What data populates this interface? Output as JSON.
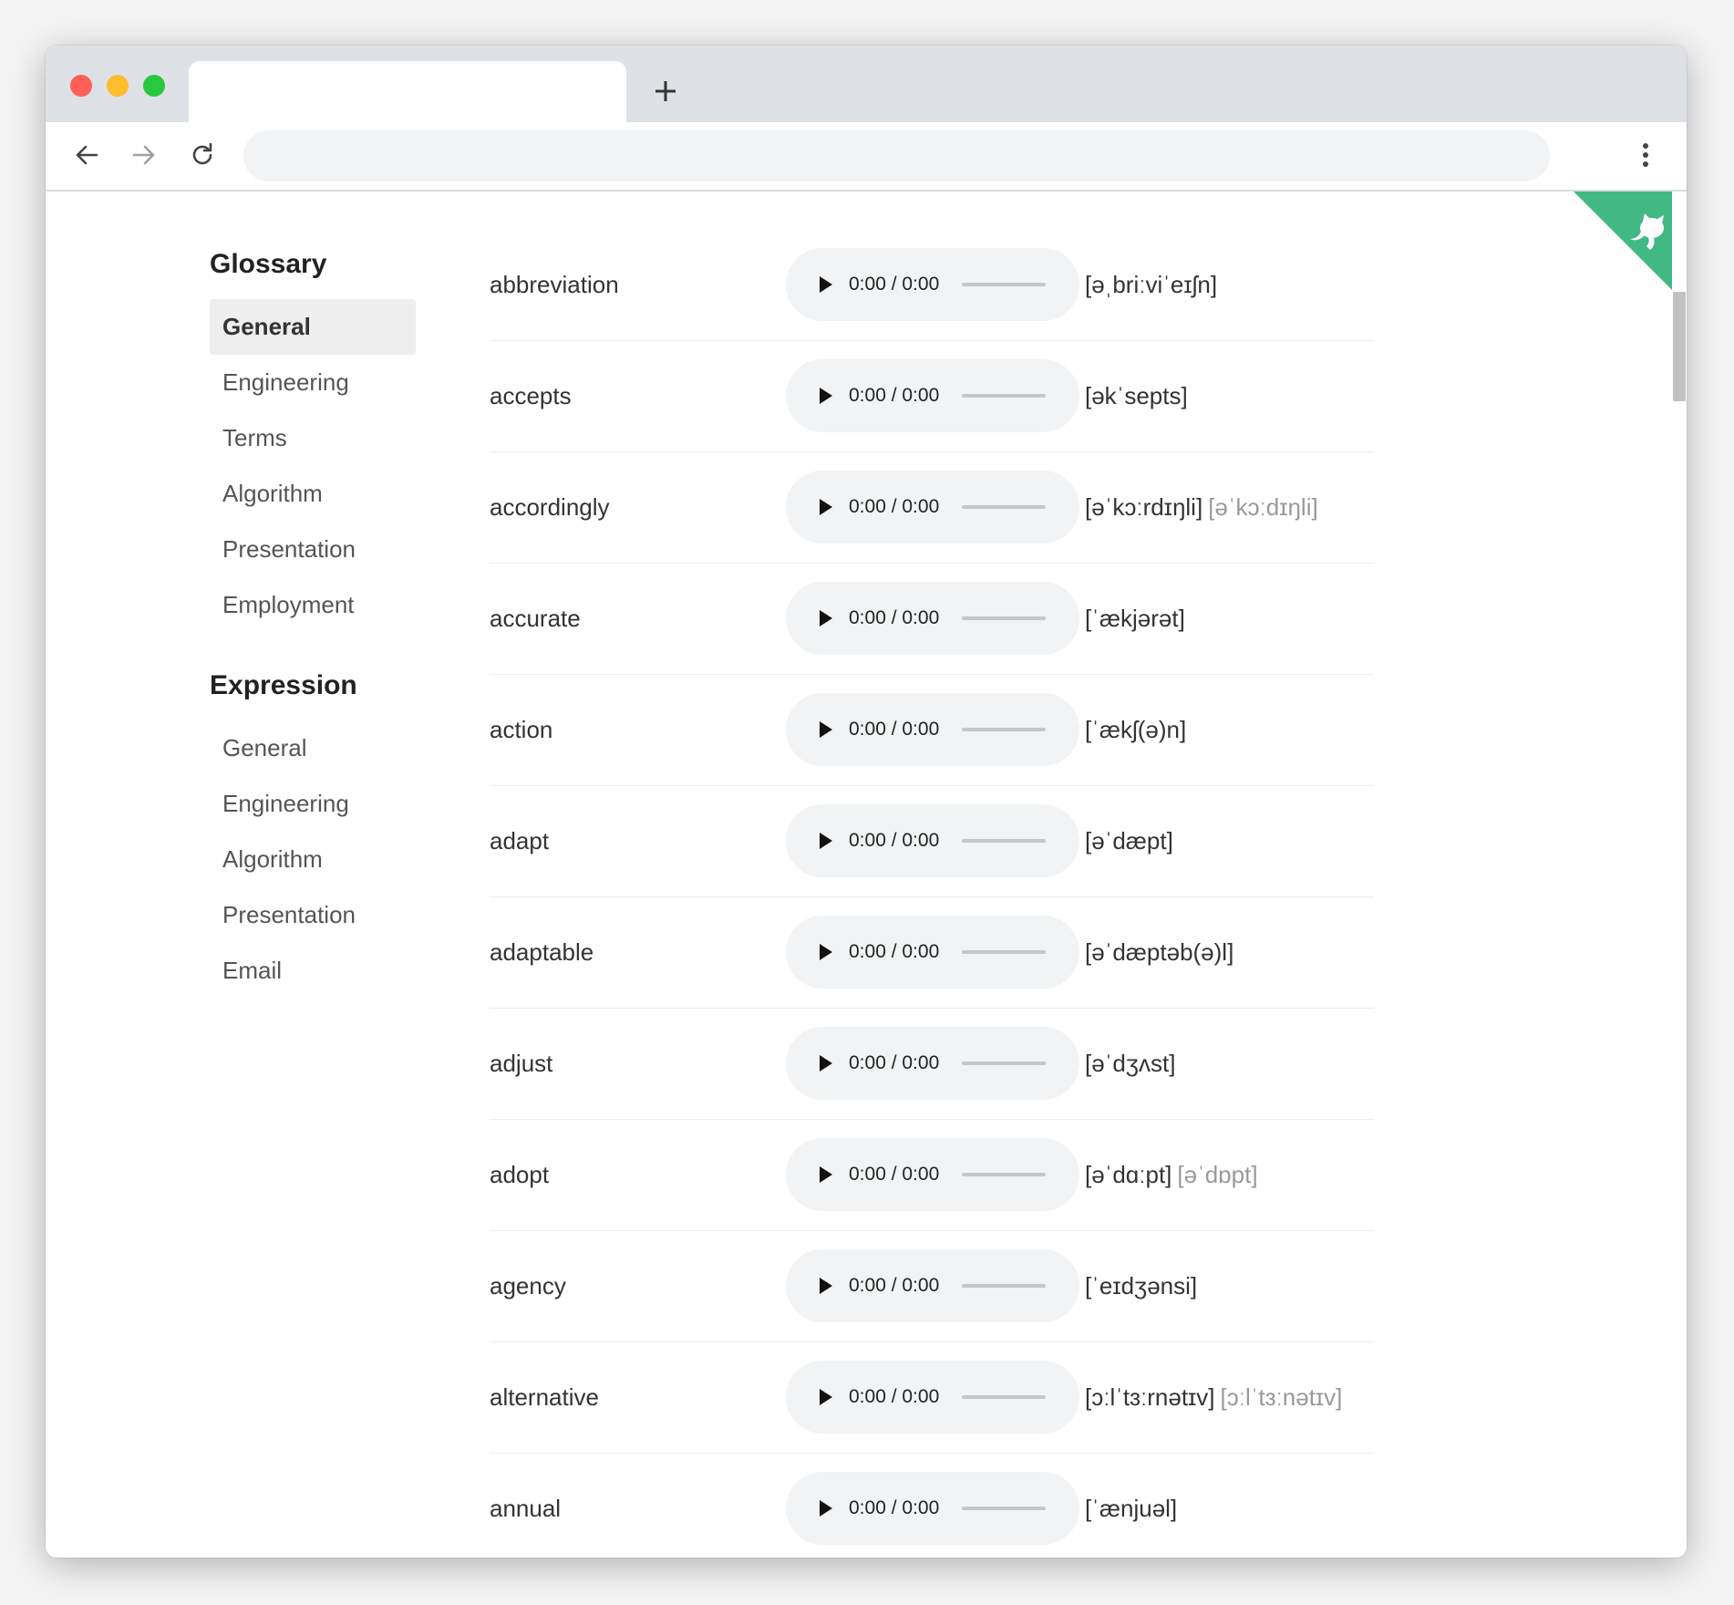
{
  "sidebar": {
    "sections": [
      {
        "title": "Glossary",
        "items": [
          "General",
          "Engineering",
          "Terms",
          "Algorithm",
          "Presentation",
          "Employment"
        ]
      },
      {
        "title": "Expression",
        "items": [
          "General",
          "Engineering",
          "Algorithm",
          "Presentation",
          "Email"
        ]
      }
    ],
    "active": "Glossary/General"
  },
  "player": {
    "time": "0:00 / 0:00",
    "progress": 0
  },
  "words": [
    {
      "word": "abbreviation",
      "us": "[əˌbriːviˈeɪʃn]",
      "uk": ""
    },
    {
      "word": "accepts",
      "us": "[əkˈsepts]",
      "uk": ""
    },
    {
      "word": "accordingly",
      "us": "[əˈkɔːrdɪŋli]",
      "uk": "[əˈkɔːdɪŋli]"
    },
    {
      "word": "accurate",
      "us": "[ˈækjərət]",
      "uk": ""
    },
    {
      "word": "action",
      "us": "[ˈækʃ(ə)n]",
      "uk": ""
    },
    {
      "word": "adapt",
      "us": "[əˈdæpt]",
      "uk": ""
    },
    {
      "word": "adaptable",
      "us": "[əˈdæptəb(ə)l]",
      "uk": ""
    },
    {
      "word": "adjust",
      "us": "[əˈdʒʌst]",
      "uk": ""
    },
    {
      "word": "adopt",
      "us": "[əˈdɑːpt]",
      "uk": "[əˈdɒpt]"
    },
    {
      "word": "agency",
      "us": "[ˈeɪdʒənsi]",
      "uk": ""
    },
    {
      "word": "alternative",
      "us": "[ɔːlˈtɜːrnətɪv]",
      "uk": "[ɔːlˈtɜːnətɪv]"
    },
    {
      "word": "annual",
      "us": "[ˈænjuəl]",
      "uk": ""
    }
  ],
  "colors": {
    "ribbon": "#42b983",
    "active_bg": "#eeeeee",
    "player_bg": "#f1f3f4"
  }
}
